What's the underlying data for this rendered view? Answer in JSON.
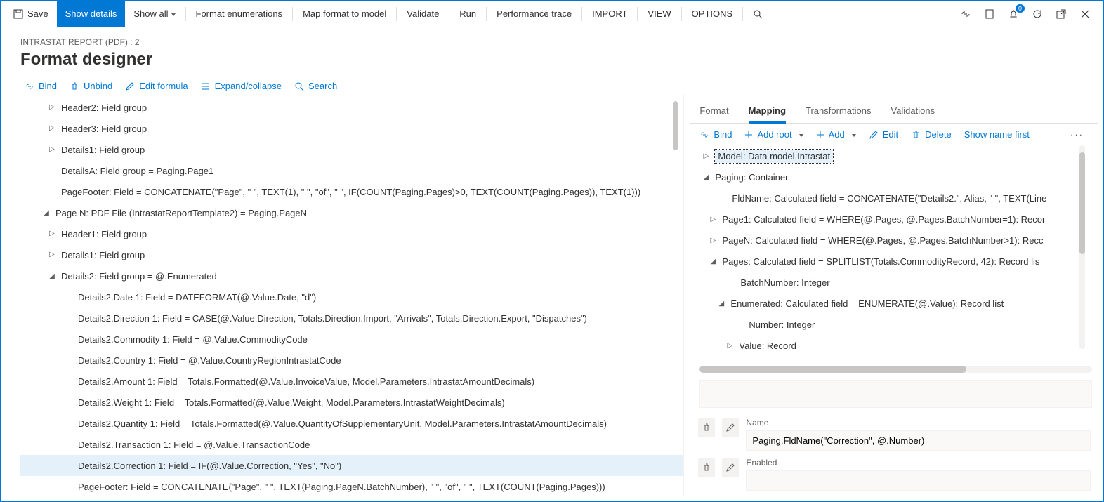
{
  "toolbar": {
    "save": "Save",
    "show_details": "Show details",
    "show_all": "Show all",
    "format_enum": "Format enumerations",
    "map_format": "Map format to model",
    "validate": "Validate",
    "run": "Run",
    "perf_trace": "Performance trace",
    "import": "IMPORT",
    "view": "VIEW",
    "options": "OPTIONS",
    "badge_count": "0"
  },
  "breadcrumb": "INTRASTAT REPORT (PDF) : 2",
  "page_title": "Format designer",
  "actions_left": {
    "bind": "Bind",
    "unbind": "Unbind",
    "edit_formula": "Edit formula",
    "expand": "Expand/collapse",
    "search": "Search"
  },
  "left_tree": [
    {
      "indent": "ind1",
      "caret": "right",
      "label": "Header2: Field group"
    },
    {
      "indent": "ind1",
      "caret": "right",
      "label": "Header3: Field group"
    },
    {
      "indent": "ind1",
      "caret": "right",
      "label": "Details1: Field group"
    },
    {
      "indent": "ind1",
      "caret": "none",
      "label": "DetailsA: Field group = Paging.Page1"
    },
    {
      "indent": "ind1",
      "caret": "none",
      "label": "PageFooter: Field = CONCATENATE(\"Page\", \" \", TEXT(1), \" \", \"of\", \" \", IF(COUNT(Paging.Pages)>0, TEXT(COUNT(Paging.Pages)), TEXT(1)))"
    },
    {
      "indent": "ind4",
      "caret": "down",
      "label": "Page N: PDF File (IntrastatReportTemplate2) = Paging.PageN"
    },
    {
      "indent": "ind1",
      "caret": "right",
      "label": "Header1: Field group"
    },
    {
      "indent": "ind1",
      "caret": "right",
      "label": "Details1: Field group"
    },
    {
      "indent": "ind1",
      "caret": "down",
      "label": "Details2: Field group = @.Enumerated"
    },
    {
      "indent": "ind2",
      "caret": "none",
      "label": "Details2.Date 1: Field = DATEFORMAT(@.Value.Date, \"d\")"
    },
    {
      "indent": "ind2",
      "caret": "none",
      "label": "Details2.Direction 1: Field = CASE(@.Value.Direction, Totals.Direction.Import, \"Arrivals\", Totals.Direction.Export, \"Dispatches\")"
    },
    {
      "indent": "ind2",
      "caret": "none",
      "label": "Details2.Commodity 1: Field = @.Value.CommodityCode"
    },
    {
      "indent": "ind2",
      "caret": "none",
      "label": "Details2.Country 1: Field = @.Value.CountryRegionIntrastatCode"
    },
    {
      "indent": "ind2",
      "caret": "none",
      "label": "Details2.Amount 1: Field = Totals.Formatted(@.Value.InvoiceValue, Model.Parameters.IntrastatAmountDecimals)"
    },
    {
      "indent": "ind2",
      "caret": "none",
      "label": "Details2.Weight 1: Field = Totals.Formatted(@.Value.Weight, Model.Parameters.IntrastatWeightDecimals)"
    },
    {
      "indent": "ind2",
      "caret": "none",
      "label": "Details2.Quantity 1: Field = Totals.Formatted(@.Value.QuantityOfSupplementaryUnit, Model.Parameters.IntrastatAmountDecimals)"
    },
    {
      "indent": "ind2",
      "caret": "none",
      "label": "Details2.Transaction 1: Field = @.Value.TransactionCode"
    },
    {
      "indent": "ind2",
      "caret": "none",
      "label": "Details2.Correction 1: Field = IF(@.Value.Correction, \"Yes\", \"No\")",
      "selected": true
    },
    {
      "indent": "ind2",
      "caret": "none",
      "label": "PageFooter: Field = CONCATENATE(\"Page\", \" \", TEXT(Paging.PageN.BatchNumber), \" \", \"of\", \" \", TEXT(COUNT(Paging.Pages)))"
    }
  ],
  "right_tabs": {
    "format": "Format",
    "mapping": "Mapping",
    "transformations": "Transformations",
    "validations": "Validations"
  },
  "right_toolbar": {
    "bind": "Bind",
    "add_root": "Add root",
    "add": "Add",
    "edit": "Edit",
    "delete": "Delete",
    "show_name_first": "Show name first"
  },
  "mapping_tree": [
    {
      "cls": "mind0",
      "caret": "right",
      "label": "Model: Data model Intrastat",
      "selected": true
    },
    {
      "cls": "mind1",
      "caret": "down",
      "label": "Paging: Container"
    },
    {
      "cls": "mind2",
      "caret": "none",
      "label": "FldName: Calculated field = CONCATENATE(\"Details2.\", Alias, \" \", TEXT(Line"
    },
    {
      "cls": "mind2b",
      "caret": "right",
      "label": "Page1: Calculated field = WHERE(@.Pages, @.Pages.BatchNumber=1): Recor"
    },
    {
      "cls": "mind2b",
      "caret": "right",
      "label": "PageN: Calculated field = WHERE(@.Pages, @.Pages.BatchNumber>1): Recc"
    },
    {
      "cls": "mind2b",
      "caret": "down",
      "label": "Pages: Calculated field = SPLITLIST(Totals.CommodityRecord, 42): Record lis"
    },
    {
      "cls": "mind3",
      "caret": "none",
      "label": "BatchNumber: Integer"
    },
    {
      "cls": "mind3b",
      "caret": "down",
      "label": "Enumerated: Calculated field = ENUMERATE(@.Value): Record list"
    },
    {
      "cls": "mind4",
      "caret": "none",
      "label": "Number: Integer"
    },
    {
      "cls": "mind4b",
      "caret": "right",
      "label": "Value: Record"
    }
  ],
  "props": {
    "name_label": "Name",
    "name_value": "Paging.FldName(\"Correction\", @.Number)",
    "enabled_label": "Enabled"
  }
}
